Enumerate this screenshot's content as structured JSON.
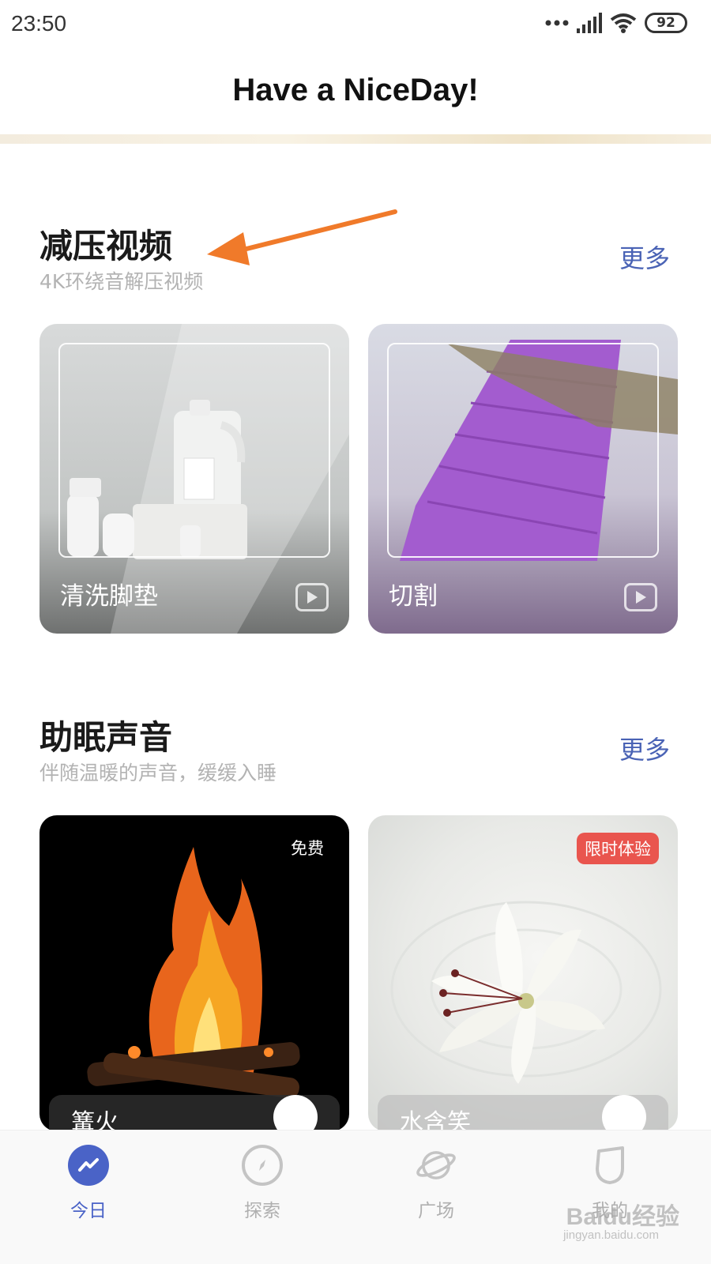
{
  "status": {
    "time": "23:50",
    "battery": "92"
  },
  "header": {
    "title": "Have a NiceDay!"
  },
  "sections": [
    {
      "title": "减压视频",
      "subtitle": "4K环绕音解压视频",
      "more": "更多",
      "cards": [
        {
          "label": "清洗脚垫"
        },
        {
          "label": "切割"
        }
      ]
    },
    {
      "title": "助眠声音",
      "subtitle": "伴随温暖的声音，缓缓入睡",
      "more": "更多",
      "cards": [
        {
          "label": "篝火",
          "badge": "免费"
        },
        {
          "label": "水含笑",
          "badge": "限时体验"
        }
      ]
    }
  ],
  "nav": [
    {
      "label": "今日",
      "active": true
    },
    {
      "label": "探索"
    },
    {
      "label": "广场"
    },
    {
      "label": "我的"
    }
  ],
  "watermark": {
    "text": "Baidu经验",
    "sub": "jingyan.baidu.com"
  },
  "colors": {
    "accent": "#4a63c7",
    "link": "#4a63b5",
    "badge": "#e9554e",
    "arrow": "#f07a2a"
  }
}
